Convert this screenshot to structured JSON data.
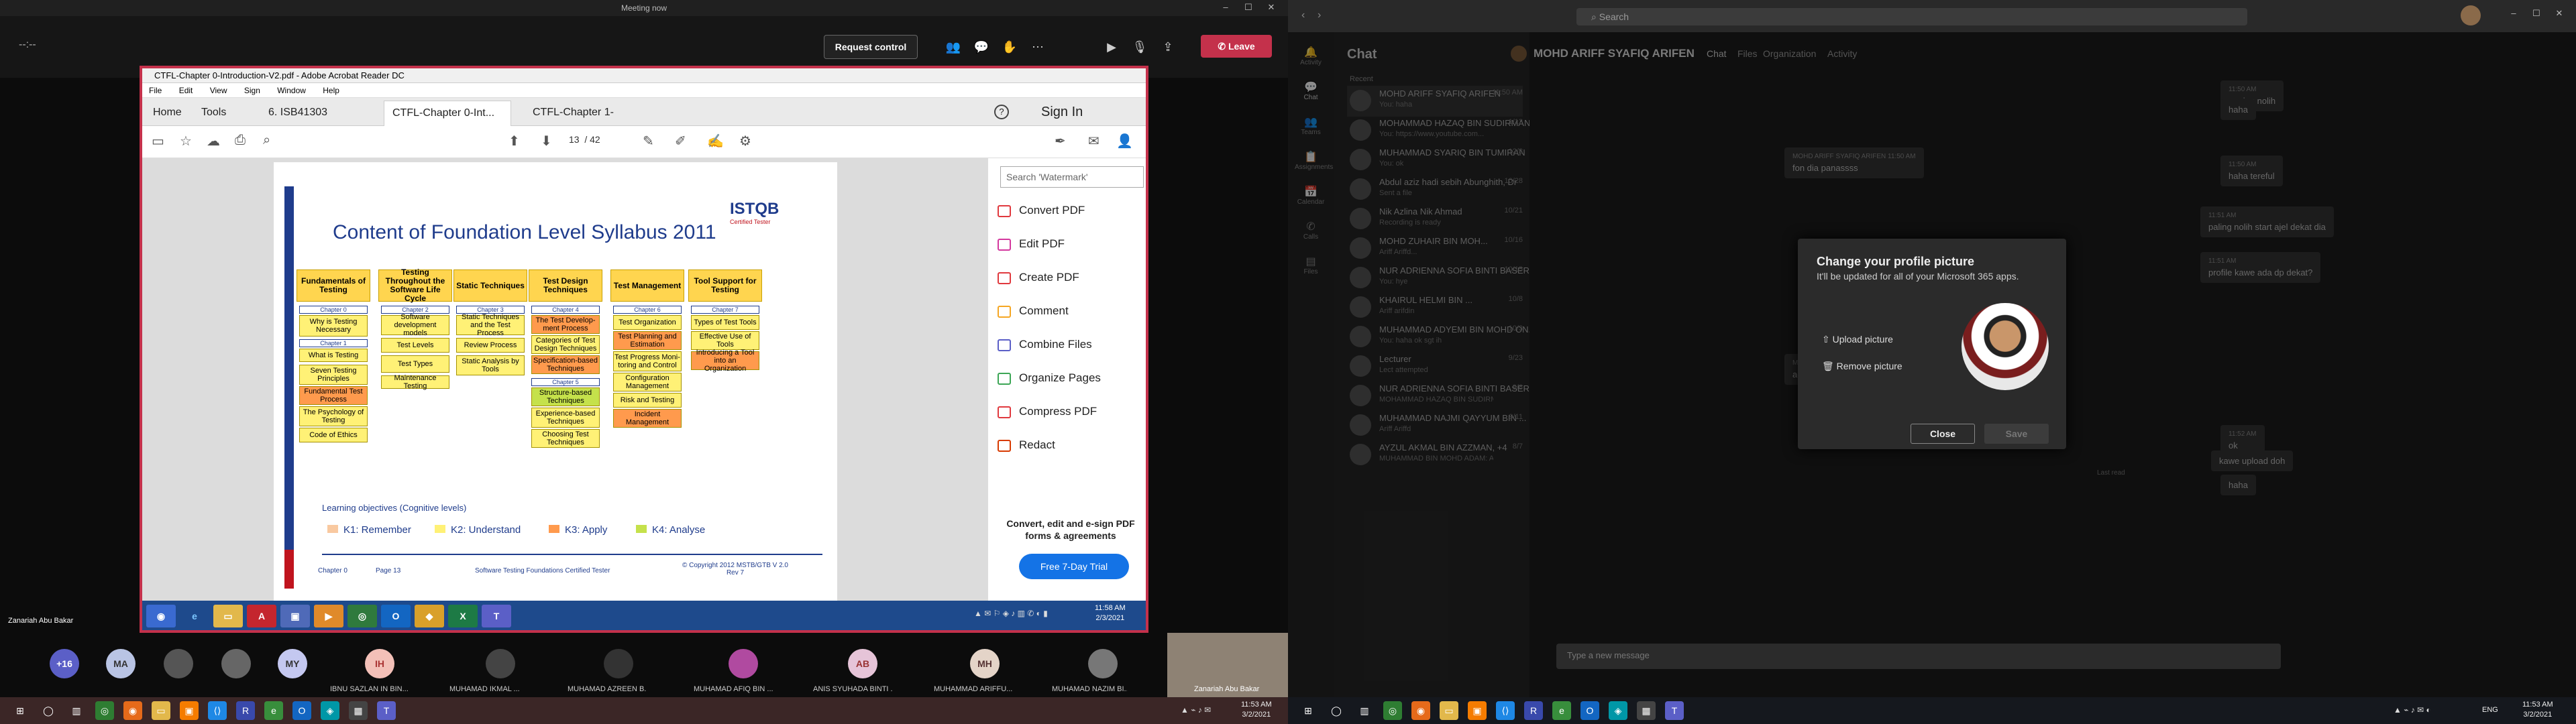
{
  "meeting": {
    "title": "Meeting now",
    "timer": "--:--",
    "request_control": "Request control",
    "leave": "Leave",
    "presenter": "Zanariah Abu Bakar"
  },
  "acrobat": {
    "title": "CTFL-Chapter 0-Introduction-V2.pdf - Adobe Acrobat Reader DC",
    "menu": [
      "File",
      "Edit",
      "View",
      "Sign",
      "Window",
      "Help"
    ],
    "tabs": [
      "Home",
      "Tools",
      "6. ISB41303 SOFT...",
      "CTFL-Chapter 0-Int...",
      "CTFL-Chapter 1-Fu..."
    ],
    "sign_in": "Sign In",
    "page_current": "13",
    "page_total": "/ 42",
    "search_placeholder": "Search 'Watermark'",
    "tools": [
      "Convert PDF",
      "Edit PDF",
      "Create PDF",
      "Comment",
      "Combine Files",
      "Organize Pages",
      "Compress PDF",
      "Redact"
    ],
    "tool_colors": [
      "#e0393e",
      "#d4389e",
      "#e0393e",
      "#f5a623",
      "#5b5fc7",
      "#3ca655",
      "#e0393e",
      "#d83b01"
    ],
    "convert_text": "Convert, edit and e-sign PDF forms & agreements",
    "trial_button": "Free 7-Day Trial",
    "task_time": "11:58 AM",
    "task_date": "2/3/2021"
  },
  "slide": {
    "title": "Content of Foundation Level Syllabus 2011",
    "logo": "ISTQB",
    "logo_sub": "Certified Tester",
    "columns": [
      {
        "head": "Fundamentals of Testing",
        "chapters": [
          "Chapter 0",
          "Chapter 1"
        ],
        "cells": [
          "Why is Testing Necessary",
          "What is Testing",
          "Seven Testing Principles",
          "Fundamental Test Process",
          "The Psychology of Testing",
          "Code of Ethics"
        ]
      },
      {
        "head": "Testing Throughout the Software Life Cycle",
        "chapters": [
          "Chapter 2"
        ],
        "cells": [
          "Software development models",
          "Test Levels",
          "Test Types",
          "Maintenance Testing"
        ]
      },
      {
        "head": "Static Techniques",
        "chapters": [
          "Chapter 3"
        ],
        "cells": [
          "Static Techniques and the Test Process",
          "Review Process",
          "Static Analysis by Tools"
        ]
      },
      {
        "head": "Test Design Techniques",
        "chapters": [
          "Chapter 4",
          "Chapter 5"
        ],
        "cells": [
          "The Test Develop-ment Process",
          "Categories of Test Design Techniques",
          "Specification-based Techniques",
          "Structure-based Techniques",
          "Experience-based Techniques",
          "Choosing Test Techniques"
        ]
      },
      {
        "head": "Test Management",
        "chapters": [
          "Chapter 6"
        ],
        "cells": [
          "Test Organization",
          "Test Planning and Estimation",
          "Test Progress Moni-toring and Control",
          "Configuration Management",
          "Risk and Testing",
          "Incident Management"
        ]
      },
      {
        "head": "Tool Support for Testing",
        "chapters": [
          "Chapter 7"
        ],
        "cells": [
          "Types of Test Tools",
          "Effective Use of Tools",
          "Introducing a Tool into an Organization"
        ]
      }
    ],
    "lo_title": "Learning objectives (Cognitive levels)",
    "legend": [
      "K1: Remember",
      "K2: Understand",
      "K3: Apply",
      "K4: Analyse"
    ],
    "legend_colors": [
      "#f9c9a0",
      "#fff176",
      "#ff9a4d",
      "#c5e14b"
    ],
    "footer_chapter": "Chapter 0",
    "footer_page": "Page 13",
    "footer_center": "Software Testing Foundations Certified Tester",
    "footer_copy": "© Copyright 2012 MSTB/GTB V 2.0 Rev 7"
  },
  "participants": {
    "more": "+16",
    "initials": [
      "MA",
      "MY",
      "IH",
      "AB",
      "MH"
    ],
    "names": [
      "IBNU SAZLAN IN BIN...",
      "MUHAMAD IKMAL ...",
      "MUHAMAD AZREEN B...",
      "MUHAMAD AFIQ BIN ...",
      "ANIS SYUHADA BINTI ...",
      "MUHAMMAD ARIFFU...",
      "MUHAMAD NAZIM BI...",
      "Zanariah Abu Bakar"
    ]
  },
  "teams": {
    "search": "Search",
    "chat_header": "Chat",
    "contact": "MOHD ARIFF SYAFIQ ARIFEN",
    "contact_tabs": [
      "Chat",
      "Files",
      "Organization",
      "Activity"
    ],
    "rail": [
      "Activity",
      "Chat",
      "Teams",
      "Assignments",
      "Calendar",
      "Calls",
      "Files"
    ],
    "recent": "Recent",
    "chats": [
      {
        "name": "MOHD ARIFF SYAFIQ ARIFEN",
        "preview": "You: haha",
        "time": "11:50 AM"
      },
      {
        "name": "MOHAMMAD HAZAQ BIN SUDIRMAN",
        "preview": "You: https://www.youtube.com...",
        "time": "1/12"
      },
      {
        "name": "MUHAMMAD SYARIQ BIN TUMIRAN",
        "preview": "You: ok",
        "time": "12/3"
      },
      {
        "name": "Abdul aziz hadi sebih Abunghith, Dr",
        "preview": "Sent a file",
        "time": "10/28"
      },
      {
        "name": "Nik Azlina Nik Ahmad",
        "preview": "Recording is ready",
        "time": "10/21"
      },
      {
        "name": "MOHD ZUHAIR BIN MOH...",
        "preview": "Ariff Ariffd...",
        "time": "10/16"
      },
      {
        "name": "NUR ADRIENNA SOFIA BINTI BASER",
        "preview": "You: hye",
        "time": "10/15"
      },
      {
        "name": "KHAIRUL HELMI BIN ...",
        "preview": "Ariff arifdin",
        "time": "10/8"
      },
      {
        "name": "MUHAMMAD ADYEMI BIN MOHD ON...",
        "preview": "You: haha ok sgt ih",
        "time": "10/3"
      },
      {
        "name": "Lecturer",
        "preview": "Lect attempted",
        "time": "9/23"
      },
      {
        "name": "NUR ADRIENNA SOFIA BINTI BASER",
        "preview": "MOHAMMAD HAZAQ BIN SUDIRMAN: Sent an...",
        "time": "9/8"
      },
      {
        "name": "MUHAMMAD NAJMI QAYYUM BIN ...",
        "preview": "Ariff Ariffd",
        "time": "9/11"
      },
      {
        "name": "AYZUL AKMAL BIN AZZMAN, +4",
        "preview": "MUHAMMAD BIN MOHD ADAM: Ariff",
        "time": "8/7"
      }
    ],
    "messages": [
      {
        "meta": "11:50 AM",
        "text": "pening nolih"
      },
      {
        "meta": "",
        "text": "haha"
      },
      {
        "meta": "MOHD ARIFF SYAFIQ ARIFEN 11:50 AM",
        "text": "fon dia panassss"
      },
      {
        "meta": "11:50 AM",
        "text": "haha tereful"
      },
      {
        "meta": "11:51 AM",
        "text": "paling nolih start ajel dekat dia"
      },
      {
        "meta": "11:51 AM",
        "text": "profile kawe ada dp dekat?"
      },
      {
        "meta": "MOHD ARIFF SYAFIQ ARIFEN 11:52 AM",
        "text": "adep"
      },
      {
        "meta": "11:52 AM",
        "text": "ok"
      },
      {
        "meta": "",
        "text": "kawe upload doh"
      },
      {
        "meta": "",
        "text": "haha"
      }
    ],
    "last_read": "Last read",
    "dialog": {
      "title": "Change your profile picture",
      "subtitle": "It'll be updated for all of your Microsoft 365 apps.",
      "upload": "Upload picture",
      "remove": "Remove picture",
      "close": "Close",
      "save": "Save"
    },
    "msg_placeholder": "Type a new message"
  },
  "taskbar": {
    "left_time": "11:53 AM",
    "left_date": "3/2/2021",
    "right_lang": "ENG",
    "right_time": "11:53 AM",
    "right_date": "3/2/2021"
  }
}
